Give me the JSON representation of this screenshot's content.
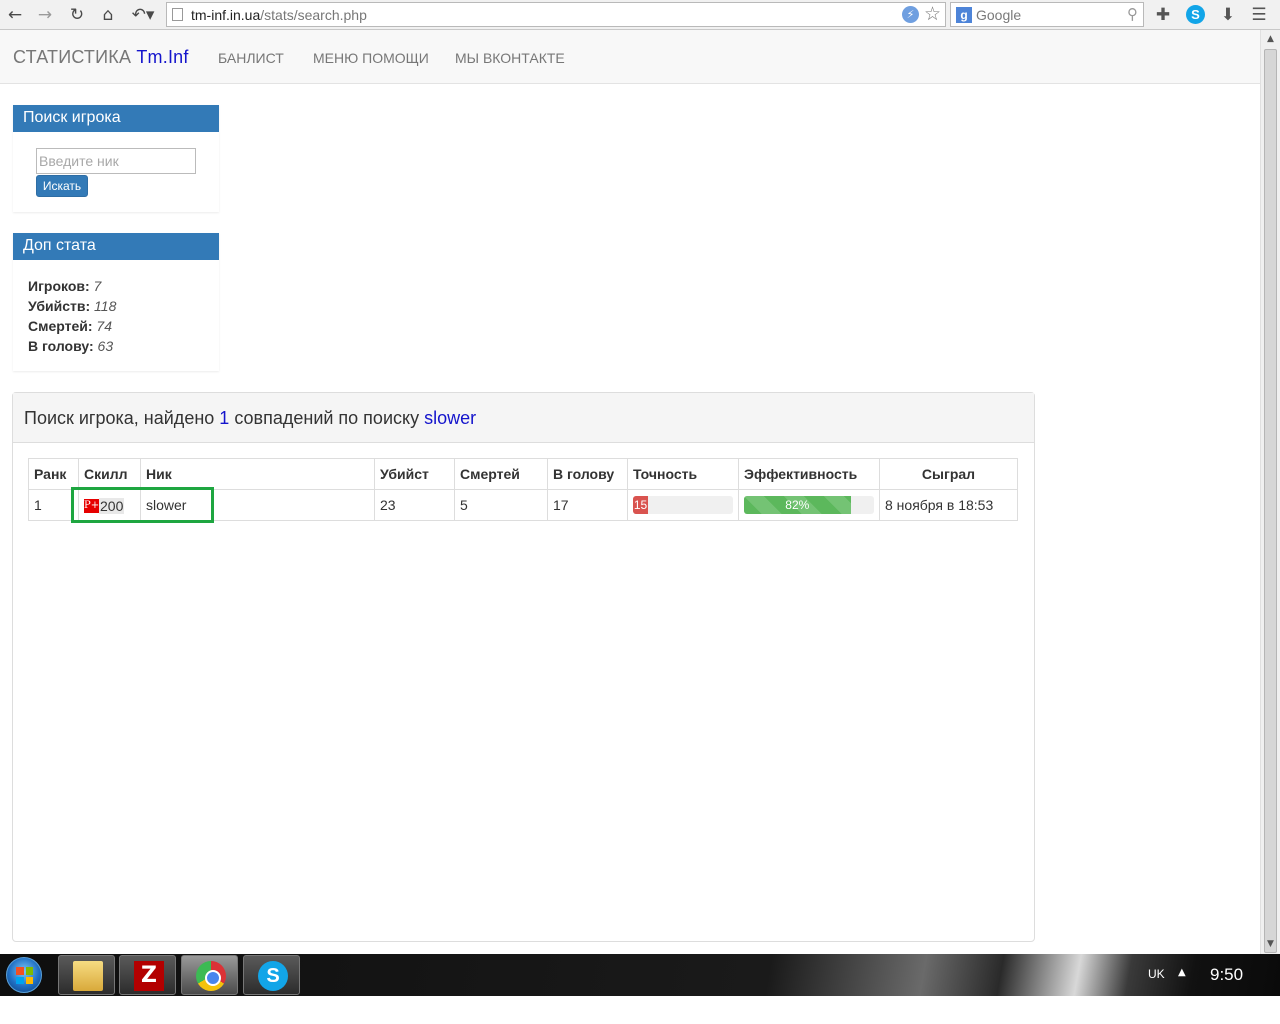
{
  "browser": {
    "url_host": "tm-inf.in.ua",
    "url_path": "/stats/search.php",
    "search_placeholder": "Google",
    "nav_icons": [
      "back-arrow-icon",
      "forward-arrow-icon",
      "reload-icon",
      "home-icon",
      "undo-icon"
    ]
  },
  "navbar": {
    "brand_text": "СТАТИСТИКА",
    "brand_highlight": "Tm.Inf",
    "links": [
      "БАНЛИСТ",
      "МЕНЮ ПОМОЩИ",
      "МЫ ВКОНТАКТЕ"
    ]
  },
  "search_panel": {
    "title": "Поиск игрока",
    "input_placeholder": "Введите ник",
    "button_label": "Искать"
  },
  "stats_panel": {
    "title": "Доп стата",
    "rows": [
      {
        "label": "Игроков:",
        "value": "7"
      },
      {
        "label": "Убийств:",
        "value": "118"
      },
      {
        "label": "Смертей:",
        "value": "74"
      },
      {
        "label": "В голову:",
        "value": "63"
      }
    ]
  },
  "results": {
    "heading_prefix": "Поиск игрока, найдено",
    "match_count": "1",
    "heading_middle": "совпадений по поиску",
    "query": "slower",
    "columns": [
      "Ранк",
      "Скилл",
      "Ник",
      "Убийст",
      "Смертей",
      "В голову",
      "Точность",
      "Эффективность",
      "Сыграл"
    ],
    "rows": [
      {
        "rank": "1",
        "skill_badge": "P+",
        "skill_value": "200",
        "nick": "slower",
        "kills": "23",
        "deaths": "5",
        "headshots": "17",
        "accuracy_label": "15",
        "accuracy_percent": 15,
        "efficiency_label": "82%",
        "efficiency_percent": 82,
        "played": "8 ноября в 18:53"
      }
    ]
  },
  "taskbar": {
    "apps": [
      "explorer-folder-icon",
      "filezilla-icon",
      "chrome-icon",
      "skype-icon"
    ],
    "language": "UK",
    "clock": "9:50"
  },
  "colors": {
    "primary": "#337ab7",
    "brand_highlight": "#1414cc",
    "accuracy_bar": "#d9534f",
    "efficiency_bar": "#5cb85c",
    "selection_box": "#1ea640"
  }
}
